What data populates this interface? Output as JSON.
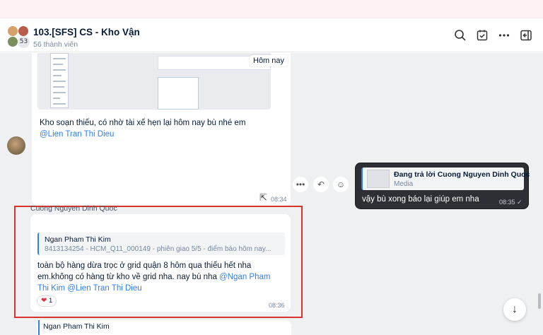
{
  "header": {
    "group_name": "103.[SFS] CS - Kho Vận",
    "members": "56 thành viên",
    "avatar_count": "53",
    "icons": [
      "search-icon",
      "calendar-check-icon",
      "more-icon",
      "sidebar-toggle-icon"
    ]
  },
  "messages": {
    "image_message": {
      "thumb_tag": "Hôm nay",
      "text": "Kho soạn thiếu, có nhờ tài xế hẹn lại hôm nay bù nhé em",
      "mention": "@Lien Tran Thi Dieu",
      "time": "08:34"
    },
    "reply_message": {
      "quote_title": "Đang trả lời Cuong Nguyen Dinh Quoc",
      "quote_sub": "Media",
      "text": "vậy bù xong báo lại giúp em nha",
      "time": "08:35"
    },
    "selected_message": {
      "sender": "Cuong Nguyen Dinh Quoc",
      "quote_name": "Ngan Pham Thi Kim",
      "quote_text": "8413134254 - HCM_Q11_000149 - phiên giao 5/5 - điểm báo hôm nay...",
      "text": "toàn bộ hàng dừa trọc ở grid quận 8 hôm qua thiếu hết nha em.không có hàng từ kho về grid nha. nay bù nha ",
      "mention1": "@Ngan Pham Thi Kim",
      "mention2": "@Lien Tran Thi Dieu",
      "reaction_count": "1",
      "time": "08:36"
    },
    "partial_message": {
      "quote_name": "Ngan Pham Thi Kim"
    }
  },
  "reaction_bar": {
    "icons": [
      "more-icon",
      "reply-icon",
      "emoji-icon"
    ]
  },
  "colors": {
    "accent": "#2f80ed",
    "selection_border": "#d9342b",
    "dark_bubble": "#2d2f34"
  }
}
